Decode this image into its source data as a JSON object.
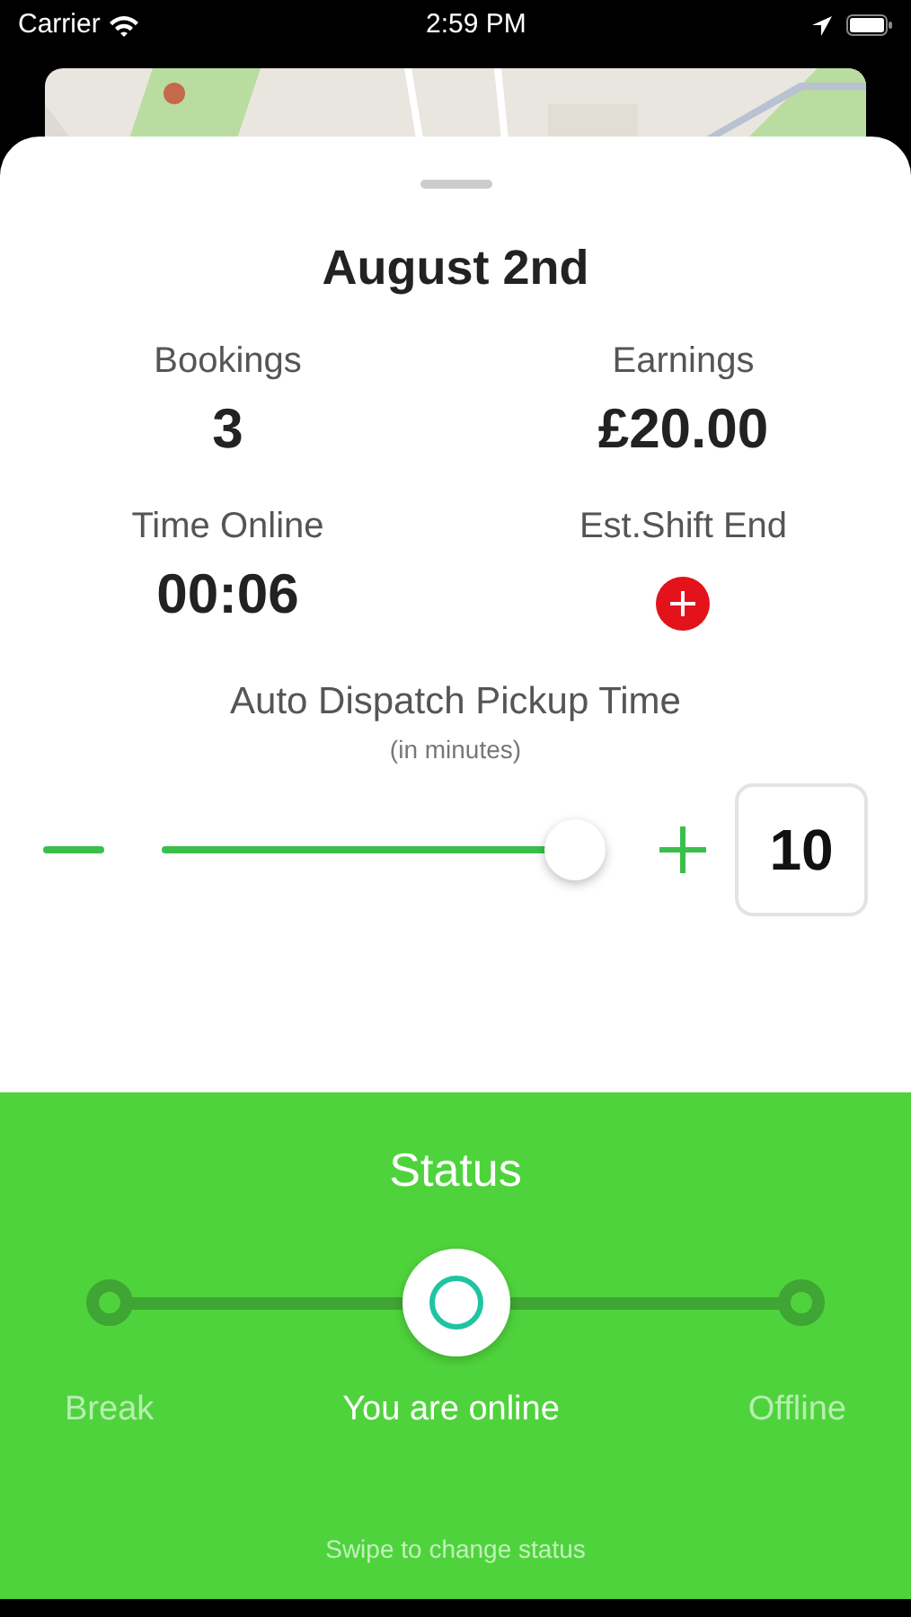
{
  "status_bar": {
    "carrier": "Carrier",
    "time": "2:59 PM"
  },
  "sheet": {
    "date": "August 2nd",
    "stats": [
      {
        "label": "Bookings",
        "value": "3",
        "kind": "text"
      },
      {
        "label": "Earnings",
        "value": "£20.00",
        "kind": "text"
      },
      {
        "label": "Time Online",
        "value": "00:06",
        "kind": "text"
      },
      {
        "label": "Est.Shift End",
        "kind": "add"
      }
    ],
    "dispatch": {
      "title": "Auto Dispatch Pickup Time",
      "subtitle": "(in minutes)",
      "level": 0.94,
      "value": "10"
    }
  },
  "status": {
    "title": "Status",
    "options": [
      {
        "label": "Break",
        "selected": false
      },
      {
        "label": "You are online",
        "selected": true
      },
      {
        "label": "Offline",
        "selected": false
      }
    ],
    "hint": "Swipe to change status"
  }
}
